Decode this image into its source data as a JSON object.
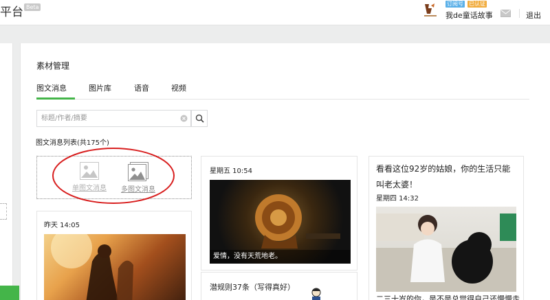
{
  "header": {
    "brand": "平台",
    "beta": "Beta",
    "badge_subscription": "订阅号",
    "badge_verified": "已认证",
    "account_name": "我de童话故事",
    "logout": "退出"
  },
  "main": {
    "section_title": "素材管理",
    "tabs": [
      {
        "label": "图文消息",
        "active": true
      },
      {
        "label": "图片库",
        "active": false
      },
      {
        "label": "语音",
        "active": false
      },
      {
        "label": "视频",
        "active": false
      }
    ],
    "search_placeholder": "标题/作者/摘要",
    "list_label": "图文消息列表(共175个)",
    "create_single": "单图文消息",
    "create_multi": "多图文消息"
  },
  "cards": [
    {
      "date": "昨天 14:05"
    },
    {
      "date": "星期五 10:54",
      "caption": "爱情，没有天荒地老。"
    },
    {
      "title_line1": "潜规则37条（写得真好）"
    },
    {
      "title_line1": "看看这位92岁的姑娘，你的生活只能",
      "title_line2": "叫老太婆！",
      "date": "星期四 14:32",
      "excerpt": "二三十岁的你，是不是总觉得自己还慢慢走"
    }
  ],
  "colors": {
    "accent_green": "#44b549",
    "highlight_red": "#d81e1e",
    "badge_blue": "#5bb0e8",
    "badge_orange": "#f1ac3e"
  },
  "icons": [
    "search-icon",
    "clear-icon",
    "mail-icon",
    "image-icon",
    "multi-image-icon"
  ]
}
